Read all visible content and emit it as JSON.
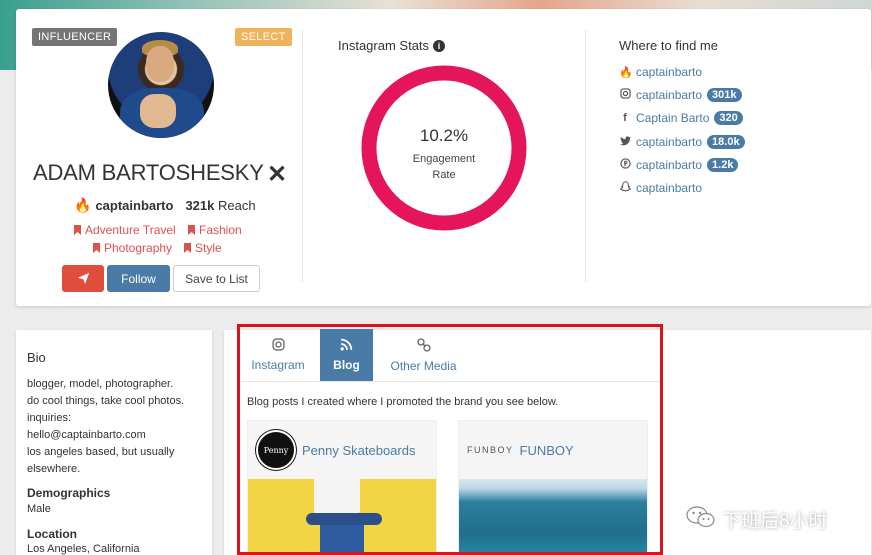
{
  "colors": {
    "accent": "#4a7ba6",
    "danger": "#e04d3c",
    "donut": "#e5155d",
    "highlight_box": "#d8141e",
    "tag": "#d9534f"
  },
  "profile": {
    "badge_left": "INFLUENCER",
    "badge_right": "SELECT",
    "name": "ADAM BARTOSHESKY",
    "remove_glyph": "✕",
    "handle": "captainbarto",
    "reach_value": "321k",
    "reach_label": "Reach",
    "tags": [
      "Adventure Travel",
      "Fashion",
      "Photography",
      "Style"
    ],
    "buttons": {
      "send_icon": "paper-plane-icon",
      "follow": "Follow",
      "save": "Save to List"
    }
  },
  "stats": {
    "title": "Instagram Stats",
    "info_glyph": "i",
    "engagement_value": "10.2%",
    "engagement_label_line1": "Engagement",
    "engagement_label_line2": "Rate"
  },
  "find": {
    "title": "Where to find me",
    "links": [
      {
        "icon": "flame-icon",
        "label": "captainbarto",
        "count": ""
      },
      {
        "icon": "instagram-icon",
        "label": "captainbarto",
        "count": "301k"
      },
      {
        "icon": "facebook-icon",
        "label": "Captain Barto",
        "count": "320"
      },
      {
        "icon": "twitter-icon",
        "label": "captainbarto",
        "count": "18.0k"
      },
      {
        "icon": "pinterest-icon",
        "label": "captainbarto",
        "count": "1.2k"
      },
      {
        "icon": "snapchat-icon",
        "label": "captainbarto",
        "count": ""
      }
    ]
  },
  "bio": {
    "heading": "Bio",
    "lines": [
      "blogger, model, photographer.",
      "do cool things, take cool photos.",
      "inquiries:",
      "hello@captainbarto.com",
      "los angeles based, but usually",
      "elsewhere."
    ],
    "demographics_heading": "Demographics",
    "demographics_value": "Male",
    "location_heading": "Location",
    "location_value": "Los Angeles, California"
  },
  "tabs": [
    {
      "label": "Instagram",
      "icon": "instagram-icon",
      "active": false
    },
    {
      "label": "Blog",
      "icon": "rss-icon",
      "active": true
    },
    {
      "label": "Other Media",
      "icon": "link-icon",
      "active": false
    }
  ],
  "blog": {
    "description": "Blog posts I created where I promoted the brand you see below.",
    "cards": [
      {
        "logo_text": "Penny",
        "name": "Penny Skateboards"
      },
      {
        "logo_text": "FUNBOY",
        "name": "FUNBOY"
      }
    ]
  },
  "watermark": "下班后8小时"
}
